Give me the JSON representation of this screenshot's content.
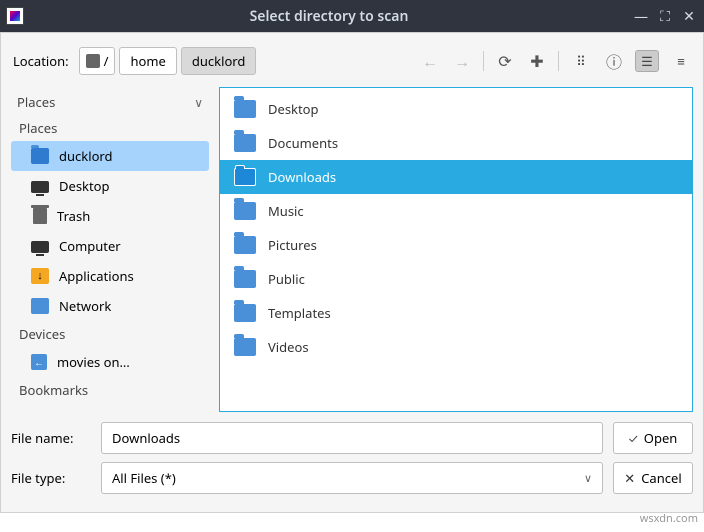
{
  "window": {
    "title": "Select directory to scan"
  },
  "location": {
    "label": "Location:",
    "root": "/",
    "seg1": "home",
    "seg2": "ducklord"
  },
  "sidebar": {
    "places_header": "Places",
    "places_sub": "Places",
    "items": [
      {
        "label": "ducklord"
      },
      {
        "label": "Desktop"
      },
      {
        "label": "Trash"
      },
      {
        "label": "Computer"
      },
      {
        "label": "Applications"
      },
      {
        "label": "Network"
      }
    ],
    "devices_header": "Devices",
    "device_item": "movies on…",
    "bookmarks_header": "Bookmarks"
  },
  "listing": {
    "items": [
      {
        "label": "Desktop"
      },
      {
        "label": "Documents"
      },
      {
        "label": "Downloads"
      },
      {
        "label": "Music"
      },
      {
        "label": "Pictures"
      },
      {
        "label": "Public"
      },
      {
        "label": "Templates"
      },
      {
        "label": "Videos"
      }
    ],
    "selected_index": 2
  },
  "bottom": {
    "filename_label": "File name:",
    "filename_value": "Downloads",
    "filetype_label": "File type:",
    "filetype_value": "All Files (*)",
    "open": "Open",
    "cancel": "Cancel"
  },
  "watermark": "wsxdn.com"
}
